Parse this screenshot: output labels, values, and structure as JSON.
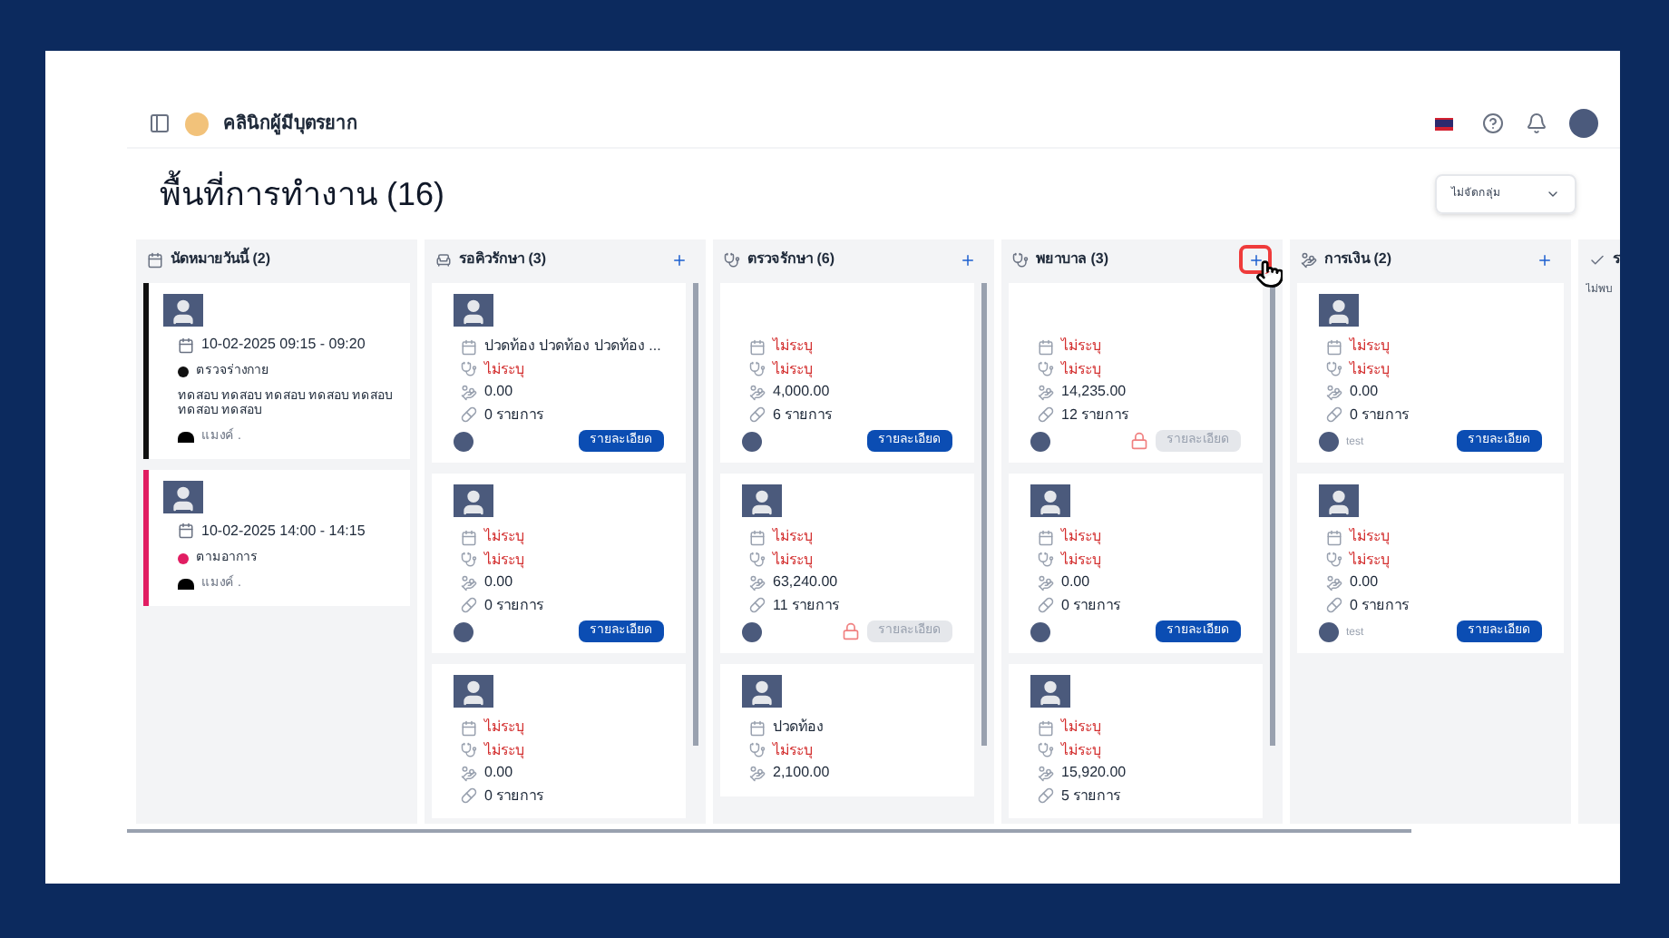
{
  "app": {
    "title": "คลินิกผู้มีบุตรยาก"
  },
  "page_title": "พื้นที่การทำงาน (16)",
  "group_select": {
    "value": "ไม่จัดกลุ่ม"
  },
  "columns": [
    {
      "kind": "appointments",
      "title": "นัดหมายวันนี้ (2)",
      "cards": [
        {
          "kind": "appointment",
          "color": "#111111",
          "datetime": "10-02-2025 09:15 - 09:20",
          "type": "ตรวจร่างกาย",
          "note": "ทดสอบ ทดสอบ ทดสอบ ทดสอบ ทดสอบ ทดสอบ ทดสอบ",
          "owner": "แมงค์ ."
        },
        {
          "kind": "appointment",
          "color": "#e11d62",
          "datetime": "10-02-2025 14:00 - 14:15",
          "type": "ตามอาการ",
          "owner": "แมงค์ ."
        }
      ]
    },
    {
      "kind": "queue",
      "title": "รอคิวรักษา (3)",
      "add": true,
      "cards": [
        {
          "kind": "patient",
          "photo": true,
          "rows": [
            {
              "kind": "complaint",
              "text": "ปวดท้อง ปวดท้อง ปวดท้อง ...",
              "missing": false
            },
            {
              "kind": "doctor",
              "text": "ไม่ระบุ",
              "missing": true
            },
            {
              "kind": "amount",
              "text": "0.00",
              "missing": false
            },
            {
              "kind": "rx",
              "text": "0 รายการ",
              "missing": false
            }
          ],
          "button": "รายละเอียด",
          "locked": false
        },
        {
          "kind": "patient",
          "photo": true,
          "rows": [
            {
              "kind": "complaint",
              "text": "ไม่ระบุ",
              "missing": true
            },
            {
              "kind": "doctor",
              "text": "ไม่ระบุ",
              "missing": true
            },
            {
              "kind": "amount",
              "text": "0.00",
              "missing": false
            },
            {
              "kind": "rx",
              "text": "0 รายการ",
              "missing": false
            }
          ],
          "button": "รายละเอียด",
          "locked": false
        },
        {
          "kind": "patient",
          "photo": true,
          "rows": [
            {
              "kind": "complaint",
              "text": "ไม่ระบุ",
              "missing": true
            },
            {
              "kind": "doctor",
              "text": "ไม่ระบุ",
              "missing": true
            },
            {
              "kind": "amount",
              "text": "0.00",
              "missing": false
            },
            {
              "kind": "rx",
              "text": "0 รายการ",
              "missing": false
            }
          ]
        }
      ]
    },
    {
      "kind": "exam",
      "title": "ตรวจรักษา (6)",
      "add": true,
      "cards": [
        {
          "kind": "patient",
          "rows": [
            {
              "kind": "complaint",
              "text": "ไม่ระบุ",
              "missing": true
            },
            {
              "kind": "doctor",
              "text": "ไม่ระบุ",
              "missing": true
            },
            {
              "kind": "amount",
              "text": "4,000.00",
              "missing": false
            },
            {
              "kind": "rx",
              "text": "6 รายการ",
              "missing": false
            }
          ],
          "button": "รายละเอียด",
          "locked": false
        },
        {
          "kind": "patient",
          "photo": true,
          "rows": [
            {
              "kind": "complaint",
              "text": "ไม่ระบุ",
              "missing": true
            },
            {
              "kind": "doctor",
              "text": "ไม่ระบุ",
              "missing": true
            },
            {
              "kind": "amount",
              "text": "63,240.00",
              "missing": false
            },
            {
              "kind": "rx",
              "text": "11 รายการ",
              "missing": false
            }
          ],
          "button": "รายละเอียด",
          "locked": true
        },
        {
          "kind": "patient",
          "photo": true,
          "rows": [
            {
              "kind": "complaint",
              "text": "ปวดท้อง",
              "missing": false
            },
            {
              "kind": "doctor",
              "text": "ไม่ระบุ",
              "missing": true
            },
            {
              "kind": "amount",
              "text": "2,100.00",
              "missing": false
            }
          ]
        }
      ]
    },
    {
      "kind": "nurse",
      "title": "พยาบาล (3)",
      "add": true,
      "add_highlighted": true,
      "cards": [
        {
          "kind": "patient",
          "rows": [
            {
              "kind": "complaint",
              "text": "ไม่ระบุ",
              "missing": true
            },
            {
              "kind": "doctor",
              "text": "ไม่ระบุ",
              "missing": true
            },
            {
              "kind": "amount",
              "text": "14,235.00",
              "missing": false
            },
            {
              "kind": "rx",
              "text": "12 รายการ",
              "missing": false
            }
          ],
          "button": "รายละเอียด",
          "locked": true
        },
        {
          "kind": "patient",
          "photo": true,
          "rows": [
            {
              "kind": "complaint",
              "text": "ไม่ระบุ",
              "missing": true
            },
            {
              "kind": "doctor",
              "text": "ไม่ระบุ",
              "missing": true
            },
            {
              "kind": "amount",
              "text": "0.00",
              "missing": false
            },
            {
              "kind": "rx",
              "text": "0 รายการ",
              "missing": false
            }
          ],
          "button": "รายละเอียด",
          "locked": false
        },
        {
          "kind": "patient",
          "photo": true,
          "rows": [
            {
              "kind": "complaint",
              "text": "ไม่ระบุ",
              "missing": true
            },
            {
              "kind": "doctor",
              "text": "ไม่ระบุ",
              "missing": true
            },
            {
              "kind": "amount",
              "text": "15,920.00",
              "missing": false
            },
            {
              "kind": "rx",
              "text": "5 รายการ",
              "missing": false
            }
          ]
        }
      ]
    },
    {
      "kind": "finance",
      "title": "การเงิน (2)",
      "add": true,
      "cards": [
        {
          "kind": "patient",
          "photo": true,
          "rows": [
            {
              "kind": "complaint",
              "text": "ไม่ระบุ",
              "missing": true
            },
            {
              "kind": "doctor",
              "text": "ไม่ระบุ",
              "missing": true
            },
            {
              "kind": "amount",
              "text": "0.00",
              "missing": false
            },
            {
              "kind": "rx",
              "text": "0 รายการ",
              "missing": false
            }
          ],
          "staff": "test",
          "button": "รายละเอียด",
          "locked": false
        },
        {
          "kind": "patient",
          "photo": true,
          "rows": [
            {
              "kind": "complaint",
              "text": "ไม่ระบุ",
              "missing": true
            },
            {
              "kind": "doctor",
              "text": "ไม่ระบุ",
              "missing": true
            },
            {
              "kind": "amount",
              "text": "0.00",
              "missing": false
            },
            {
              "kind": "rx",
              "text": "0 รายการ",
              "missing": false
            }
          ],
          "staff": "test",
          "button": "รายละเอียด",
          "locked": false
        }
      ]
    },
    {
      "kind": "done",
      "title": "ร",
      "empty": "ไม่พบ"
    }
  ]
}
